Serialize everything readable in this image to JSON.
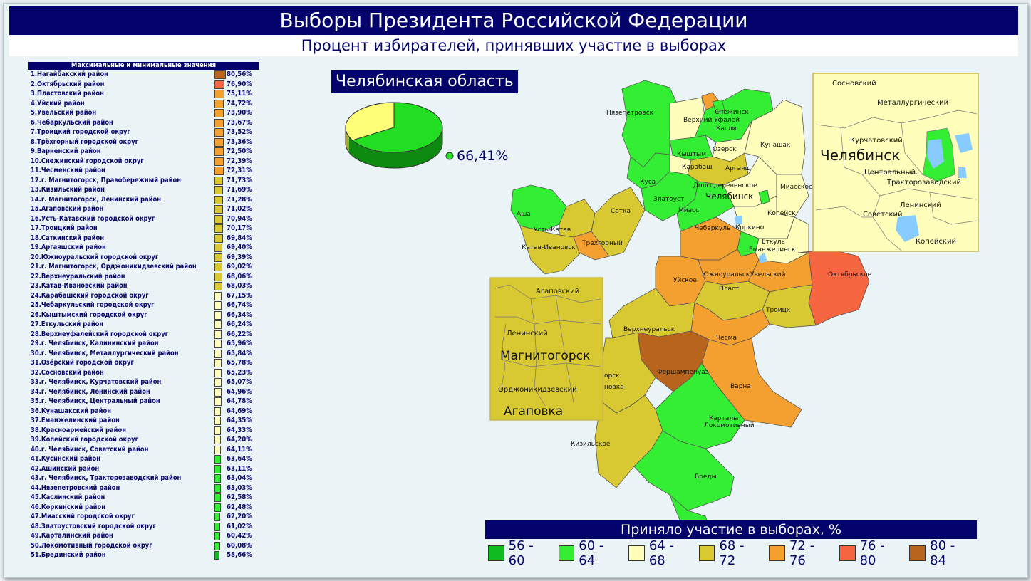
{
  "header": {
    "title": "Выборы Президента Российской Федерации",
    "subtitle": "Процент избирателей, принявших участие в выборах"
  },
  "ranking": {
    "title": "Максимальные и минимальные значения",
    "scale_min": 56,
    "scale_max": 84,
    "items": [
      {
        "label": "1.Нагайбакский район",
        "value": "80,56%",
        "pct": 80.56
      },
      {
        "label": "2.Октябрьский район",
        "value": "76,90%",
        "pct": 76.9
      },
      {
        "label": "3.Пластовский район",
        "value": "75,11%",
        "pct": 75.11
      },
      {
        "label": "4.Уйский район",
        "value": "74,72%",
        "pct": 74.72
      },
      {
        "label": "5.Увельский район",
        "value": "73,90%",
        "pct": 73.9
      },
      {
        "label": "6.Чебаркульский район",
        "value": "73,67%",
        "pct": 73.67
      },
      {
        "label": "7.Троицкий городской округ",
        "value": "73,52%",
        "pct": 73.52
      },
      {
        "label": "8.Трёхгорный городской округ",
        "value": "73,36%",
        "pct": 73.36
      },
      {
        "label": "9.Варненский район",
        "value": "72,50%",
        "pct": 72.5
      },
      {
        "label": "10.Снежинский городской округ",
        "value": "72,39%",
        "pct": 72.39
      },
      {
        "label": "11.Чесменский район",
        "value": "72,31%",
        "pct": 72.31
      },
      {
        "label": "12.г. Магнитогорск, Правобережный район",
        "value": "71,73%",
        "pct": 71.73
      },
      {
        "label": "13.Кизильский район",
        "value": "71,69%",
        "pct": 71.69
      },
      {
        "label": "14.г. Магнитогорск, Ленинский район",
        "value": "71,28%",
        "pct": 71.28
      },
      {
        "label": "15.Агаповский район",
        "value": "71,02%",
        "pct": 71.02
      },
      {
        "label": "16.Усть-Катавский городской округ",
        "value": "70,94%",
        "pct": 70.94
      },
      {
        "label": "17.Троицкий район",
        "value": "70,17%",
        "pct": 70.17
      },
      {
        "label": "18.Саткинский район",
        "value": "69,84%",
        "pct": 69.84
      },
      {
        "label": "19.Аргаяшский район",
        "value": "69,40%",
        "pct": 69.4
      },
      {
        "label": "20.Южноуральский городской округ",
        "value": "69,39%",
        "pct": 69.39
      },
      {
        "label": "21.г. Магнитогорск, Орджоникидзевский район",
        "value": "69,02%",
        "pct": 69.02
      },
      {
        "label": "22.Верхнеуральский район",
        "value": "68,06%",
        "pct": 68.06
      },
      {
        "label": "23.Катав-Ивановский район",
        "value": "68,03%",
        "pct": 68.03
      },
      {
        "label": "24.Карабашский городской округ",
        "value": "67,15%",
        "pct": 67.15
      },
      {
        "label": "25.Чебаркульский городской округ",
        "value": "66,74%",
        "pct": 66.74
      },
      {
        "label": "26.Кыштымский городской округ",
        "value": "66,34%",
        "pct": 66.34
      },
      {
        "label": "27.Еткульский район",
        "value": "66,24%",
        "pct": 66.24
      },
      {
        "label": "28.Верхнеуфалейский городской округ",
        "value": "66,22%",
        "pct": 66.22
      },
      {
        "label": "29.г. Челябинск, Калининский район",
        "value": "65,96%",
        "pct": 65.96
      },
      {
        "label": "30.г. Челябинск, Металлургический район",
        "value": "65,84%",
        "pct": 65.84
      },
      {
        "label": "31.Озёрский городской округ",
        "value": "65,78%",
        "pct": 65.78
      },
      {
        "label": "32.Сосновский район",
        "value": "65,23%",
        "pct": 65.23
      },
      {
        "label": "33.г. Челябинск, Курчатовский район",
        "value": "65,07%",
        "pct": 65.07
      },
      {
        "label": "34.г. Челябинск, Ленинский район",
        "value": "64,96%",
        "pct": 64.96
      },
      {
        "label": "35.г. Челябинск, Центральный район",
        "value": "64,78%",
        "pct": 64.78
      },
      {
        "label": "36.Кунашакский район",
        "value": "64,69%",
        "pct": 64.69
      },
      {
        "label": "37.Еманжелинский район",
        "value": "64,35%",
        "pct": 64.35
      },
      {
        "label": "38.Красноармейский район",
        "value": "64,33%",
        "pct": 64.33
      },
      {
        "label": "39.Копейский городской округ",
        "value": "64,20%",
        "pct": 64.2
      },
      {
        "label": "40.г. Челябинск, Советский район",
        "value": "64,11%",
        "pct": 64.11
      },
      {
        "label": "41.Кусинский район",
        "value": "63,64%",
        "pct": 63.64
      },
      {
        "label": "42.Ашинский район",
        "value": "63,11%",
        "pct": 63.11
      },
      {
        "label": "43.г. Челябинск, Тракторозаводский район",
        "value": "63,04%",
        "pct": 63.04
      },
      {
        "label": "44.Нязепетровский район",
        "value": "63,03%",
        "pct": 63.03
      },
      {
        "label": "45.Каслинский район",
        "value": "62,58%",
        "pct": 62.58
      },
      {
        "label": "46.Коркинский район",
        "value": "62,48%",
        "pct": 62.48
      },
      {
        "label": "47.Миасский городской округ",
        "value": "62,20%",
        "pct": 62.2
      },
      {
        "label": "48.Златоустовский городской округ",
        "value": "61,02%",
        "pct": 61.02
      },
      {
        "label": "49.Карталинский район",
        "value": "60,42%",
        "pct": 60.42
      },
      {
        "label": "50.Локомотивный городской округ",
        "value": "60,08%",
        "pct": 60.08
      },
      {
        "label": "51.Брединский район",
        "value": "58,66%",
        "pct": 58.66
      }
    ]
  },
  "summary": {
    "region": "Челябинская область",
    "turnout_label": "66,41%",
    "turnout": 66.41,
    "pie_colors": {
      "participated": "#22dd22",
      "participated_side": "#109010",
      "other": "#ffff77",
      "other_side": "#b8b82a"
    }
  },
  "map": {
    "inset_chelyabinsk": {
      "city": "Челябинск",
      "districts": [
        "Сосновский",
        "Металлургический",
        "Курчатовский",
        "Центральный",
        "Тракторозаводский",
        "Ленинский",
        "Советский",
        "Копейский"
      ]
    },
    "inset_magnitogorsk": {
      "city": "Магнитогорск",
      "area": "Агаповка",
      "districts": [
        "Агаповский",
        "Ленинский",
        "Орджоникидзевский"
      ]
    },
    "labels": [
      "Нязепетровск",
      "Снежинск",
      "Верхний Уфалей",
      "Касли",
      "Кыштым",
      "Озерск",
      "Кунашак",
      "Карабаш",
      "Аргаяш",
      "Долгодеревенское",
      "Челябинск",
      "Миасское",
      "Куса",
      "Златоуст",
      "Миасс",
      "Копейск",
      "Аша",
      "Сатка",
      "Усть-Катав",
      "Трехгорный",
      "Катав-Ивановск",
      "Чебаркуль",
      "Коркино",
      "Еткуль",
      "Еманжелинск",
      "Уйское",
      "Южноуральск",
      "Увельский",
      "Октябрьское",
      "Пласт",
      "Троицк",
      "Верхнеуральск",
      "Чесма",
      "Фершампенуаз",
      "Варна",
      "Карталы",
      "Локомотивный",
      "Кизильское",
      "Бреды",
      "орск",
      "новка"
    ]
  },
  "legend": {
    "title": "Приняло участие в выборах, %",
    "items": [
      {
        "label": "56 - 60",
        "color": "#11bb22"
      },
      {
        "label": "60 - 64",
        "color": "#33ee33"
      },
      {
        "label": "64 - 68",
        "color": "#ffffbb"
      },
      {
        "label": "68 - 72",
        "color": "#d8c832"
      },
      {
        "label": "72 - 76",
        "color": "#f4a030"
      },
      {
        "label": "76 - 80",
        "color": "#f56540"
      },
      {
        "label": "80 - 84",
        "color": "#b8641c"
      }
    ]
  }
}
